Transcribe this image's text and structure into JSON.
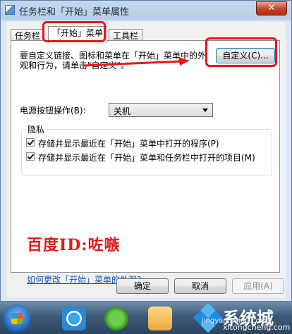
{
  "window": {
    "title": "任务栏和「开始」菜单属性",
    "close_label": "✕"
  },
  "tabs": [
    {
      "label": "任务栏"
    },
    {
      "label": "「开始」菜单"
    },
    {
      "label": "工具栏"
    }
  ],
  "start_menu": {
    "description": "要自定义链接、图标和菜单在「开始」菜单中的外观和行为，请单击\"自定义\"。",
    "customize_label": "自定义(C)...",
    "power_label": "电源按钮操作(B):",
    "power_value": "关机",
    "privacy": {
      "title": "隐私",
      "items": [
        {
          "label": "存储并显示最近在「开始」菜单中打开的程序(P)",
          "checked": true
        },
        {
          "label": "存储并显示最近在「开始」菜单和任务栏中打开的项目(M)",
          "checked": true
        }
      ]
    },
    "appearance_link": "如何更改「开始」菜单的外观?"
  },
  "overlay": {
    "watermark": "百度ID:咗嗾",
    "highlight_color": "#e8161a"
  },
  "buttons": {
    "ok": "确定",
    "cancel": "取消",
    "apply": "应用(A)"
  },
  "taskbar": {
    "brand_name": "系统城",
    "brand_domain": "xitongcheng.com",
    "brand_mini": "jingyan.baidu.com"
  }
}
